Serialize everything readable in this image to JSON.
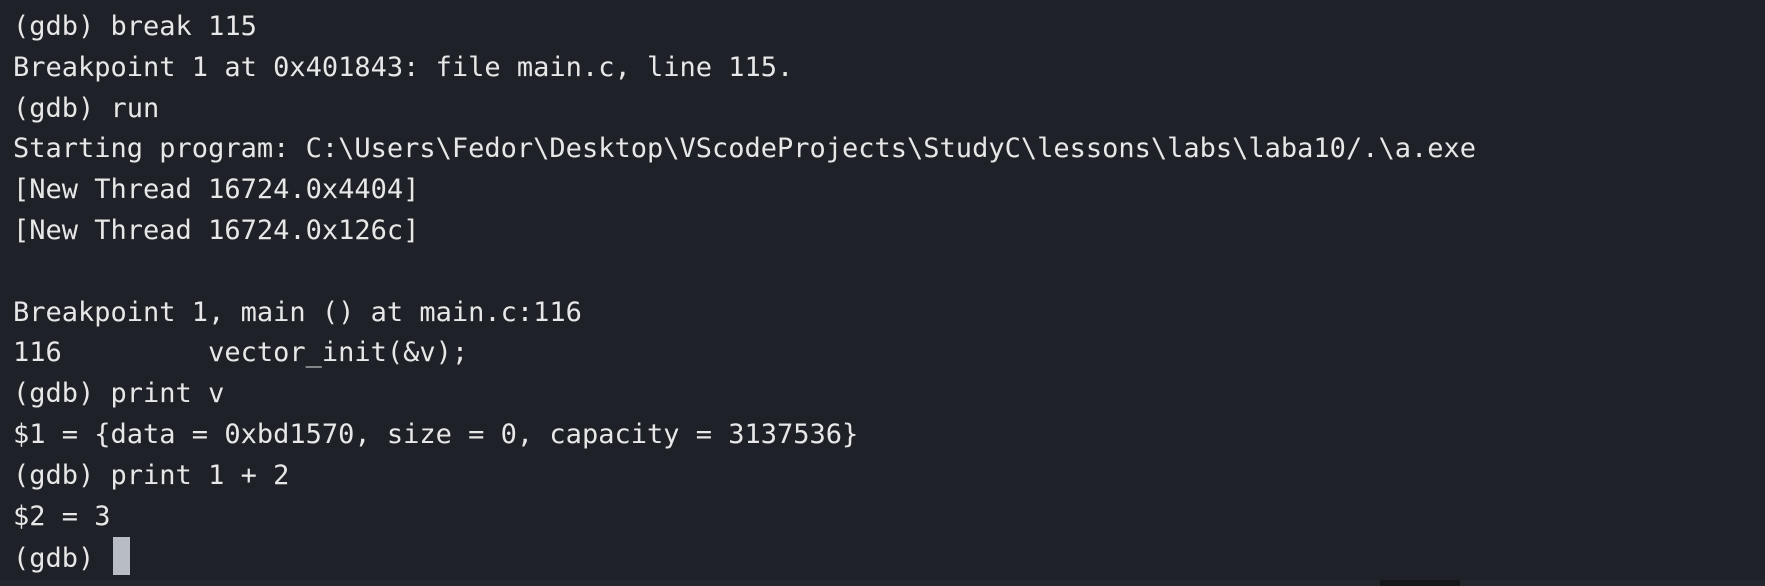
{
  "terminal": {
    "lines": [
      "(gdb) break 115",
      "Breakpoint 1 at 0x401843: file main.c, line 115.",
      "(gdb) run",
      "Starting program: C:\\Users\\Fedor\\Desktop\\VScodeProjects\\StudyC\\lessons\\labs\\laba10/.\\a.exe",
      "[New Thread 16724.0x4404]",
      "[New Thread 16724.0x126c]",
      "",
      "Breakpoint 1, main () at main.c:116",
      "116         vector_init(&v);",
      "(gdb) print v",
      "$1 = {data = 0xbd1570, size = 0, capacity = 3137536}",
      "(gdb) print 1 + 2",
      "$2 = 3"
    ],
    "prompt": "(gdb) ",
    "colors": {
      "background": "#1e2127",
      "text": "#e7e7e7",
      "cursor": "#b8bcc4"
    }
  }
}
